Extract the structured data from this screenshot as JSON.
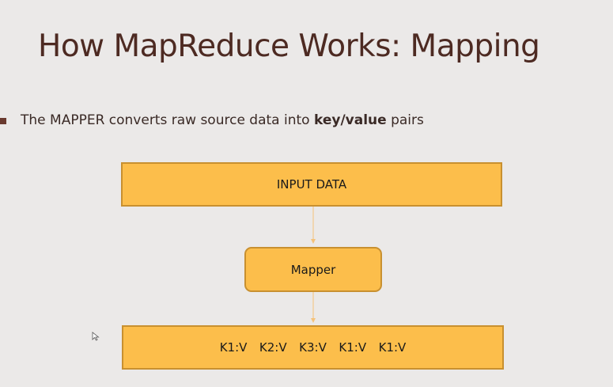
{
  "slide": {
    "title": "How MapReduce Works: Mapping",
    "bullet": {
      "prefix": "The MAPPER converts raw source data into ",
      "emphasis": "key/value",
      "suffix": " pairs"
    }
  },
  "diagram": {
    "input_label": "INPUT DATA",
    "mapper_label": "Mapper",
    "output_label": "K1:V  K2:V  K3:V  K1:V  K1:V"
  },
  "colors": {
    "background": "#ebe9e8",
    "title": "#4d2a22",
    "box_fill": "#fcbe4b",
    "box_border": "#c89030",
    "arrow": "#f5c27a"
  }
}
